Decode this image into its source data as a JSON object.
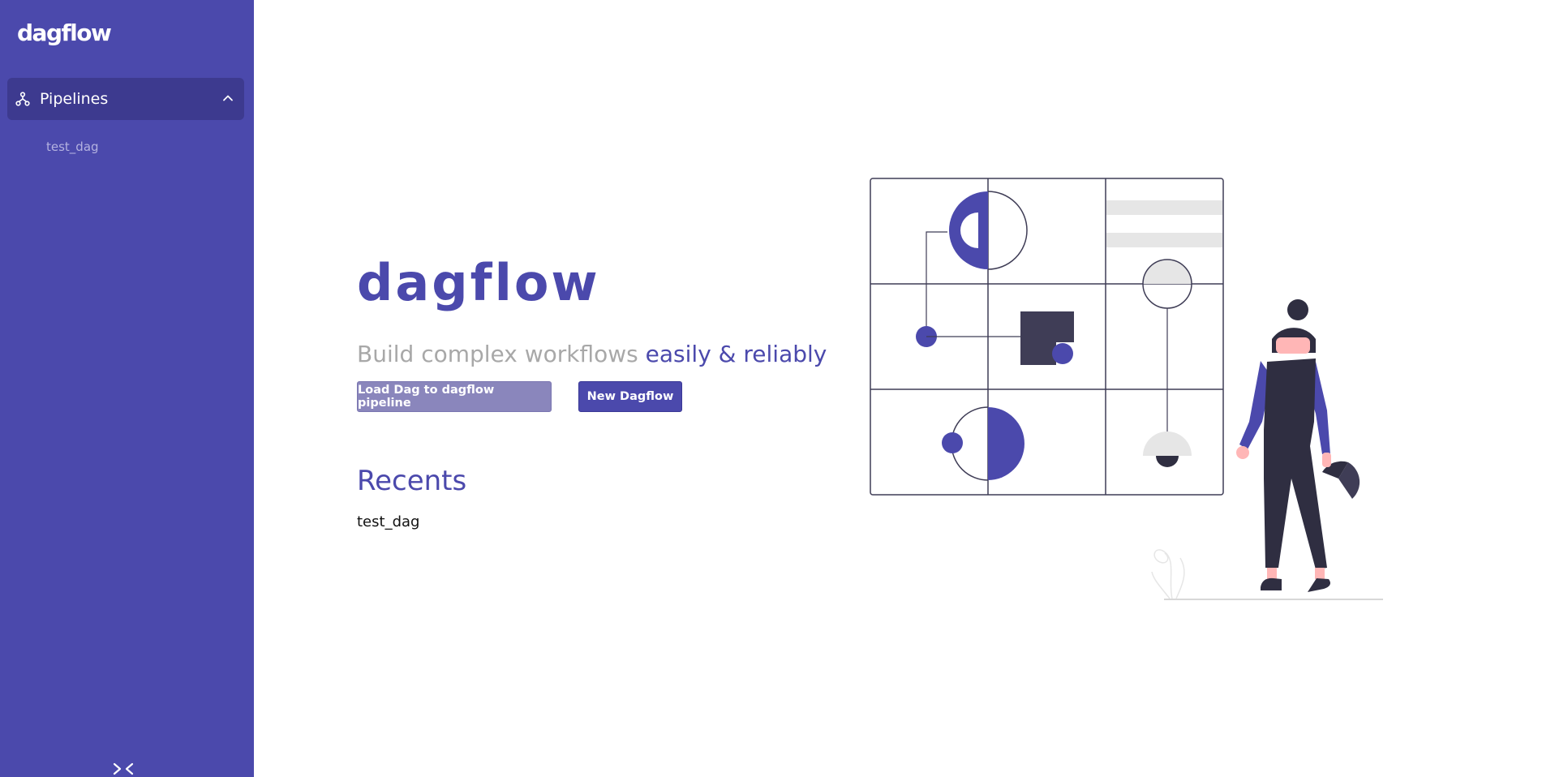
{
  "sidebar": {
    "brand": "dagflow",
    "nav": {
      "pipelines_label": "Pipelines",
      "items": [
        "test_dag"
      ]
    }
  },
  "main": {
    "title": "dagflow",
    "tagline_muted": "Build complex workflows ",
    "tagline_accent": "easily & reliably",
    "buttons": {
      "load_label": "Load Dag to dagflow pipeline",
      "new_label": "New Dagflow"
    },
    "recents": {
      "title": "Recents",
      "items": [
        "test_dag"
      ]
    }
  },
  "colors": {
    "brand": "#4b49ac",
    "sidebar_active": "#3d3a8f",
    "muted_button": "#8a86bc",
    "dark": "#2f2e41",
    "skin": "#ffb6b6",
    "light_gray": "#e6e6e6"
  },
  "icons": {
    "pipelines": "pipeline-icon",
    "expand": "chevron-up-icon",
    "collapse": "collapse-sidebar-icon"
  }
}
